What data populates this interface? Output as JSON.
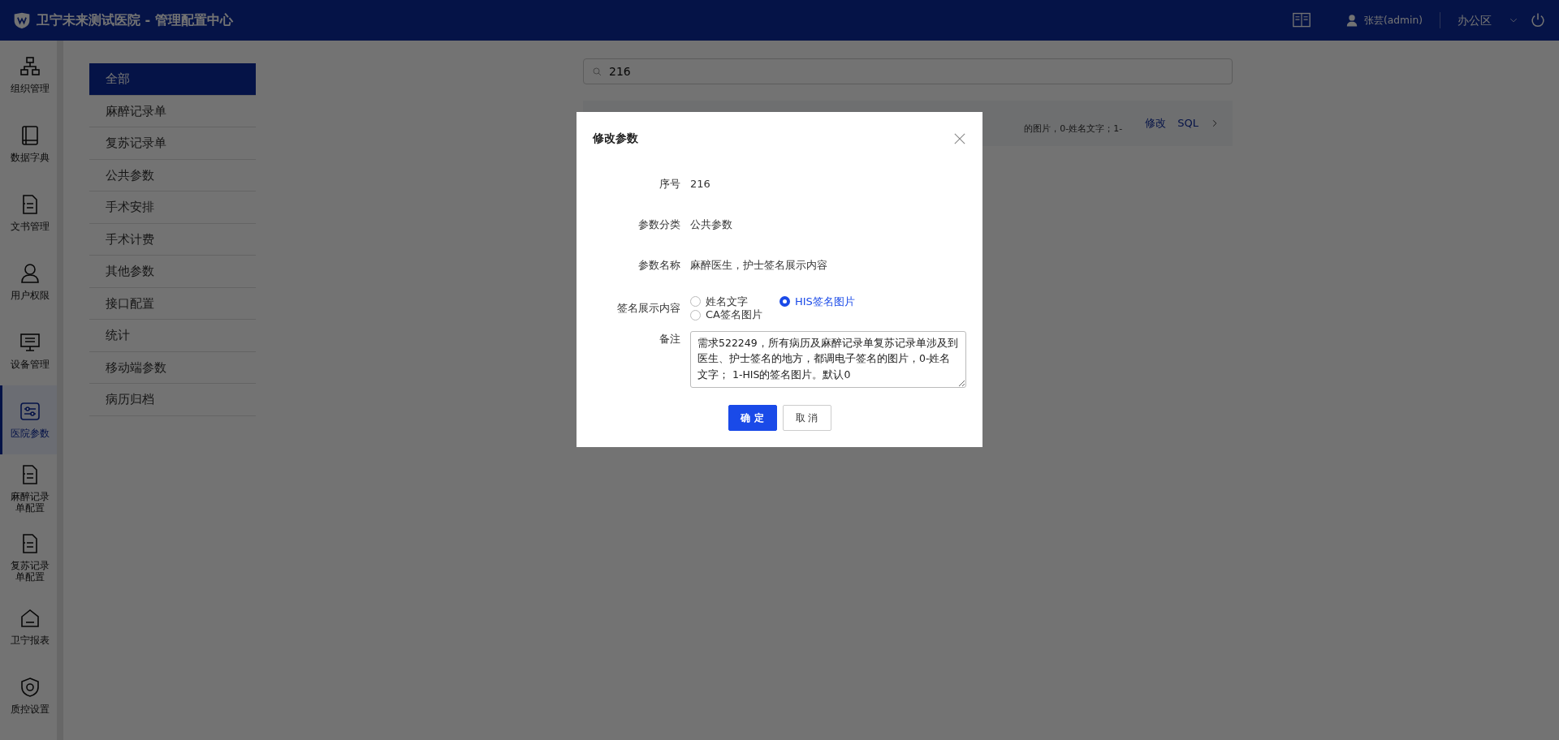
{
  "header": {
    "title": "卫宁未来测试医院 - 管理配置中心",
    "user": "张芸(admin)",
    "area": "办公区"
  },
  "rail": [
    {
      "label": "组织管理",
      "selected": false
    },
    {
      "label": "数据字典",
      "selected": false
    },
    {
      "label": "文书管理",
      "selected": false
    },
    {
      "label": "用户权限",
      "selected": false
    },
    {
      "label": "设备管理",
      "selected": false
    },
    {
      "label": "医院参数",
      "selected": true
    },
    {
      "label": "麻醉记录单配置",
      "selected": false
    },
    {
      "label": "复苏记录单配置",
      "selected": false
    },
    {
      "label": "卫宁报表",
      "selected": false
    },
    {
      "label": "质控设置",
      "selected": false
    }
  ],
  "categories": [
    {
      "label": "全部",
      "selected": true
    },
    {
      "label": "麻醉记录单",
      "selected": false
    },
    {
      "label": "复苏记录单",
      "selected": false
    },
    {
      "label": "公共参数",
      "selected": false
    },
    {
      "label": "手术安排",
      "selected": false
    },
    {
      "label": "手术计费",
      "selected": false
    },
    {
      "label": "其他参数",
      "selected": false
    },
    {
      "label": "接口配置",
      "selected": false
    },
    {
      "label": "统计",
      "selected": false
    },
    {
      "label": "移动端参数",
      "selected": false
    },
    {
      "label": "病历归档",
      "selected": false
    }
  ],
  "search": {
    "value": "216"
  },
  "result_row": {
    "description": "的图片，0-姓名文字；1-",
    "actions": [
      "修改",
      "SQL"
    ]
  },
  "dialog": {
    "title": "修改参数",
    "fields": [
      {
        "kind": "text",
        "label": "序号",
        "value": "216"
      },
      {
        "kind": "text",
        "label": "参数分类",
        "value": "公共参数"
      },
      {
        "kind": "text",
        "label": "参数名称",
        "value": "麻醉医生，护士签名展示内容"
      },
      {
        "kind": "radio",
        "label": "签名展示内容",
        "options": [
          {
            "label": "姓名文字",
            "selected": false
          },
          {
            "label": "HIS签名图片",
            "selected": true
          },
          {
            "label": "CA签名图片",
            "selected": false
          }
        ]
      },
      {
        "kind": "textarea",
        "label": "备注",
        "value": "需求522249，所有病历及麻醉记录单复苏记录单涉及到医生、护士签名的地方，都调电子签名的图片，0-姓名文字； 1-HIS的签名图片。默认0"
      }
    ],
    "buttons": [
      {
        "label": "确 定",
        "primary": true
      },
      {
        "label": "取 消",
        "primary": false
      }
    ]
  }
}
